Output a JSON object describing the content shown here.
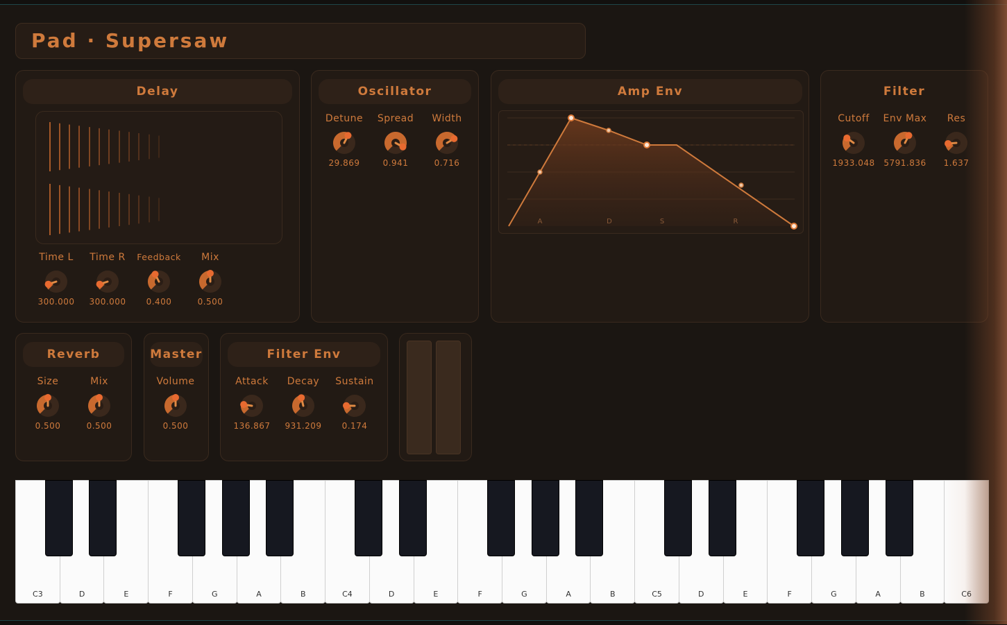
{
  "preset_title": "Pad · Supersaw",
  "colors": {
    "accent": "#cf7a3c",
    "panel": "#221a14",
    "background": "#1b1612"
  },
  "delay": {
    "header": "Delay",
    "knobs": [
      {
        "label": "Time L",
        "value": "300.000",
        "level": 0.1
      },
      {
        "label": "Time R",
        "value": "300.000",
        "level": 0.1
      },
      {
        "label": "Feedback",
        "value": "0.400",
        "level": 0.4
      },
      {
        "label": "Mix",
        "value": "0.500",
        "level": 0.5
      }
    ]
  },
  "oscillator": {
    "header": "Oscillator",
    "knobs": [
      {
        "label": "Detune",
        "value": "29.869",
        "level": 0.6
      },
      {
        "label": "Spread",
        "value": "0.941",
        "level": 0.94
      },
      {
        "label": "Width",
        "value": "0.716",
        "level": 0.72
      }
    ]
  },
  "amp_env": {
    "header": "Amp Env",
    "stage_labels": [
      "A",
      "D",
      "S",
      "R"
    ]
  },
  "filter": {
    "header": "Filter",
    "knobs": [
      {
        "label": "Cutoff",
        "value": "1933.048",
        "level": 0.3
      },
      {
        "label": "Env Max",
        "value": "5791.836",
        "level": 0.6
      },
      {
        "label": "Res",
        "value": "1.637",
        "level": 0.15
      }
    ]
  },
  "reverb": {
    "header": "Reverb",
    "knobs": [
      {
        "label": "Size",
        "value": "0.500",
        "level": 0.5
      },
      {
        "label": "Mix",
        "value": "0.500",
        "level": 0.5
      }
    ]
  },
  "master": {
    "header": "Master",
    "knobs": [
      {
        "label": "Volume",
        "value": "0.500",
        "level": 0.5
      }
    ]
  },
  "filter_env": {
    "header": "Filter Env",
    "knobs": [
      {
        "label": "Attack",
        "value": "136.867",
        "level": 0.2
      },
      {
        "label": "Decay",
        "value": "931.209",
        "level": 0.45
      },
      {
        "label": "Sustain",
        "value": "0.174",
        "level": 0.17
      }
    ]
  },
  "keyboard": {
    "white_keys": [
      "C3",
      "D",
      "E",
      "F",
      "G",
      "A",
      "B",
      "C4",
      "D",
      "E",
      "F",
      "G",
      "A",
      "B",
      "C5",
      "D",
      "E",
      "F",
      "G",
      "A",
      "B",
      "C6"
    ]
  }
}
